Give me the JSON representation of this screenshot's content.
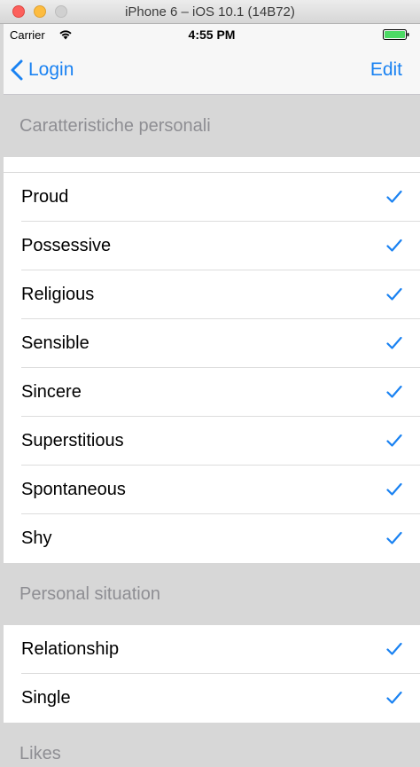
{
  "window": {
    "title": "iPhone 6 – iOS 10.1 (14B72)"
  },
  "status_bar": {
    "carrier": "Carrier",
    "time": "4:55 PM"
  },
  "nav": {
    "back_label": "Login",
    "edit_label": "Edit"
  },
  "sections": [
    {
      "header": "Caratteristiche personali",
      "items": [
        "Proud",
        "Possessive",
        "Religious",
        "Sensible",
        "Sincere",
        "Superstitious",
        "Spontaneous",
        "Shy"
      ]
    },
    {
      "header": "Personal situation",
      "items": [
        "Relationship",
        "Single"
      ]
    },
    {
      "header": "Likes",
      "items": []
    }
  ],
  "colors": {
    "accent": "#1a82f2",
    "header_bg": "#d7d7d7",
    "header_text": "#8e8e93"
  },
  "icons": {
    "back": "chevron-left-icon",
    "check": "checkmark-icon",
    "wifi": "wifi-icon",
    "battery": "battery-icon"
  }
}
